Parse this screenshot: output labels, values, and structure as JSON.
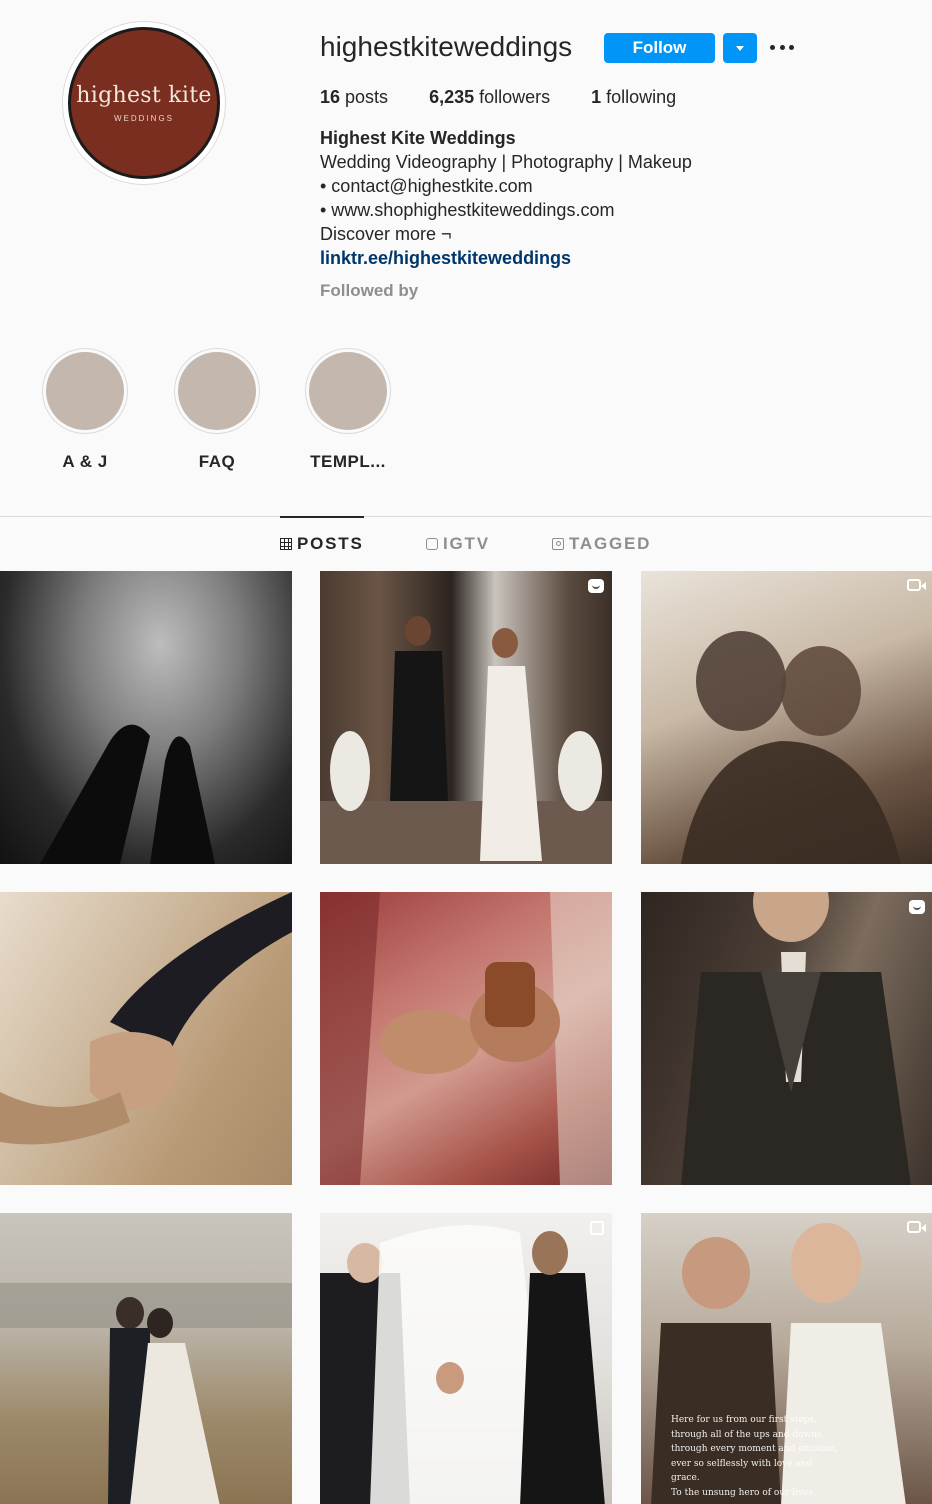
{
  "profile": {
    "username": "highestkiteweddings",
    "follow_label": "Follow",
    "avatar_logo_main": "highest kite",
    "avatar_logo_sub": "WEDDINGS",
    "avatar_color": "#7a2e1f"
  },
  "stats": [
    {
      "count": "16",
      "label": " posts"
    },
    {
      "count": "6,235",
      "label": " followers"
    },
    {
      "count": "1",
      "label": " following"
    }
  ],
  "bio": {
    "name": "Highest Kite Weddings",
    "line1": "Wedding Videography | Photography | Makeup",
    "line2": "• contact@highestkite.com",
    "line3": "• www.shophighestkiteweddings.com",
    "line4": "Discover more ¬",
    "link": "linktr.ee/highestkiteweddings",
    "followed_by": "Followed by"
  },
  "highlights": [
    {
      "label": "A & J"
    },
    {
      "label": "FAQ"
    },
    {
      "label": "TEMPL..."
    }
  ],
  "tabs": [
    {
      "label": "POSTS",
      "icon": "grid-icon",
      "active": true
    },
    {
      "label": "IGTV",
      "icon": "igtv-icon",
      "active": false
    },
    {
      "label": "TAGGED",
      "icon": "tagged-icon",
      "active": false
    }
  ],
  "posts": [
    {
      "subject": "silhouette hands touching",
      "badge": "none"
    },
    {
      "subject": "couple walking down aisle",
      "badge": "igtv-icon"
    },
    {
      "subject": "couple embrace backlit",
      "badge": "video-icon"
    },
    {
      "subject": "holding hands close-up",
      "badge": "none"
    },
    {
      "subject": "bride bangles and garland",
      "badge": "none"
    },
    {
      "subject": "groom in suit",
      "badge": "igtv-icon"
    },
    {
      "subject": "couple in grass field",
      "badge": "none"
    },
    {
      "subject": "veil lifting",
      "badge": "carousel-icon"
    },
    {
      "subject": "bride with mother",
      "badge": "video-icon"
    }
  ],
  "post_9_caption": [
    "Here for us from our first steps,",
    "through all of the ups and downs,",
    "through every moment and emotion,",
    "ever so selflessly with love and grace.",
    "To the unsung hero of our lives,"
  ],
  "colors": {
    "accent": "#0095f6",
    "link": "#00376b",
    "muted": "#8e8e8e"
  }
}
